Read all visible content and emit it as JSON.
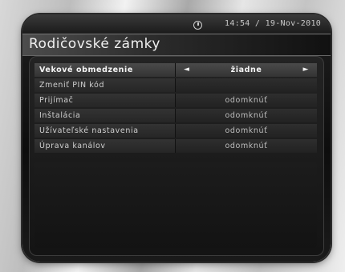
{
  "header": {
    "datetime": "14:54 / 19-Nov-2010",
    "clock_icon": "clock-icon"
  },
  "title": "Rodičovské zámky",
  "menu": {
    "rows": [
      {
        "label": "Vekové obmedzenie",
        "value": "žiadne",
        "selected": true
      },
      {
        "label": "Zmeniť PIN kód",
        "value": ""
      },
      {
        "label": "Prijímač",
        "value": "odomknúť"
      },
      {
        "label": "Inštalácia",
        "value": "odomknúť"
      },
      {
        "label": "Užívateľské nastavenia",
        "value": "odomknúť"
      },
      {
        "label": "Úprava kanálov",
        "value": "odomknúť"
      }
    ],
    "left_arrow": "◄",
    "right_arrow": "►"
  }
}
